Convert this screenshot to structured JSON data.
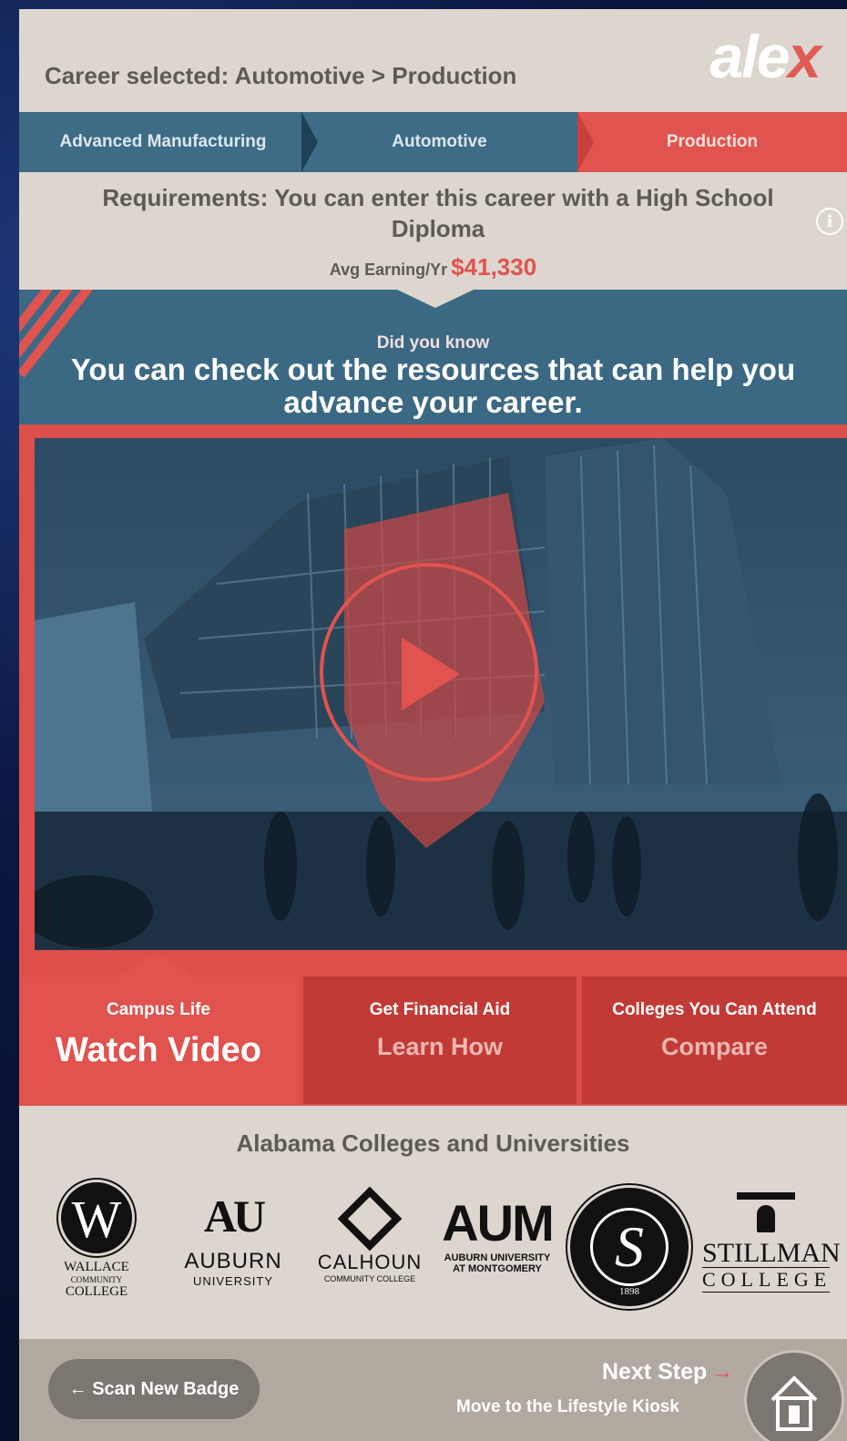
{
  "header": {
    "career_selected": "Career selected: Automotive > Production",
    "logo_main": "ale",
    "logo_accent": "x"
  },
  "breadcrumb": [
    {
      "label": "Advanced Manufacturing"
    },
    {
      "label": "Automotive"
    },
    {
      "label": "Production"
    }
  ],
  "requirements": {
    "text": "Requirements: You can enter this career with a High School Diploma",
    "earning_label": "Avg Earning/Yr",
    "earning_value": "$41,330"
  },
  "did_you_know": {
    "label": "Did you know",
    "message": "You can check out the resources that can help you advance your career."
  },
  "tabs": [
    {
      "title": "Campus Life",
      "action": "Watch Video",
      "state": "active"
    },
    {
      "title": "Get Financial Aid",
      "action": "Learn How",
      "state": "inactive"
    },
    {
      "title": "Colleges You Can Attend",
      "action": "Compare",
      "state": "inactive"
    }
  ],
  "colleges": {
    "heading": "Alabama Colleges and Universities",
    "logos": {
      "wallace": {
        "mark": "W",
        "line1": "WALLACE",
        "line2": "COMMUNITY",
        "line3": "COLLEGE"
      },
      "auburn": {
        "mark": "AU",
        "line1": "AUBURN",
        "line2": "UNIVERSITY"
      },
      "calhoun": {
        "line1": "CALHOUN",
        "line2": "COMMUNITY COLLEGE"
      },
      "aum": {
        "mark": "AUM",
        "line1": "AUBURN UNIVERSITY",
        "line2": "AT MONTGOMERY"
      },
      "snead": {
        "mark": "S",
        "year": "1898"
      },
      "stillman": {
        "line1": "STILLMAN",
        "line2": "COLLEGE"
      }
    }
  },
  "footer": {
    "scan_label": "Scan New Badge",
    "next_label": "Next Step",
    "next_sub": "Move to the Lifestyle Kiosk"
  },
  "icons": {
    "info": "info-icon",
    "play": "play-icon",
    "back_arrow": "arrow-left-icon",
    "next_arrow": "arrow-right-icon",
    "home": "home-icon"
  },
  "colors": {
    "accent_red": "#e0534f",
    "dark_red": "#c23a36",
    "teal_blue": "#3b6984",
    "background": "#dcd6cf",
    "footer": "#b1a9a0"
  }
}
